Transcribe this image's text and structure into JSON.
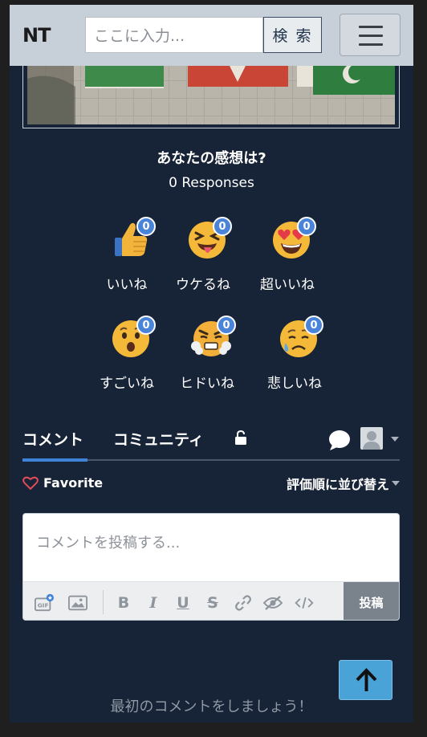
{
  "header": {
    "logo": "NT",
    "search_placeholder": "ここに入力...",
    "search_button": "検 索"
  },
  "reactions": {
    "title": "あなたの感想は?",
    "responses": "0 Responses",
    "items": [
      {
        "icon": "thumbs-up-icon",
        "count": "0",
        "label": "いいね"
      },
      {
        "icon": "tongue-laugh-icon",
        "count": "0",
        "label": "ウケるね"
      },
      {
        "icon": "heart-eyes-icon",
        "count": "0",
        "label": "超いいね"
      },
      {
        "icon": "surprised-face-icon",
        "count": "0",
        "label": "すごいね"
      },
      {
        "icon": "angry-steam-icon",
        "count": "0",
        "label": "ヒドいね"
      },
      {
        "icon": "sad-face-icon",
        "count": "0",
        "label": "悲しいね"
      }
    ]
  },
  "tabs": {
    "comments": "コメント",
    "community": "コミュニティ"
  },
  "comments": {
    "favorite": "Favorite",
    "sort": "評価順に並び替え",
    "placeholder": "コメントを投稿する...",
    "post_button": "投稿",
    "empty_message": "最初のコメントをしましょう！"
  },
  "toolbar": {
    "gif_label": "GIF",
    "bold_label": "B",
    "italic_label": "I",
    "underline_label": "U",
    "strike_label": "S"
  },
  "colors": {
    "background": "#172336",
    "header": "#c7cfd8",
    "accent": "#3f83d8",
    "badge": "#4a84d9",
    "scroll_top": "#4aa3d6"
  }
}
